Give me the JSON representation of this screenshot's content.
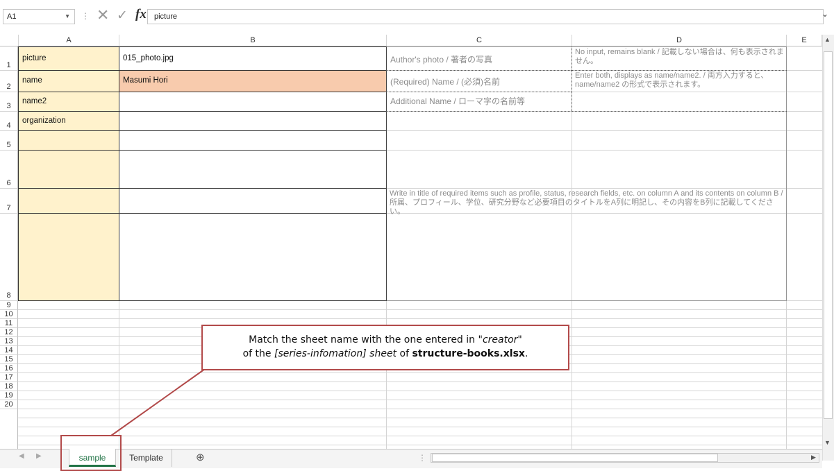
{
  "formula_bar": {
    "name_box": "A1",
    "value": "picture",
    "cancel_icon": "✕",
    "enter_icon": "✓",
    "fx_icon": "fx"
  },
  "columns": [
    "A",
    "B",
    "C",
    "D",
    "E"
  ],
  "rows": [
    "1",
    "2",
    "3",
    "4",
    "5",
    "6",
    "7",
    "8",
    "9",
    "10",
    "11",
    "12",
    "13",
    "14",
    "15",
    "16",
    "17",
    "18",
    "19",
    "20"
  ],
  "cells": {
    "A1": "picture",
    "B1": "015_photo.jpg",
    "A2": "name",
    "B2": "Masumi Hori",
    "A3": "name2",
    "A4": "organization",
    "C1": "Author's photo / 著者の写真",
    "C2": "(Required) Name / (必須)名前",
    "C3": "Additional Name / ローマ字の名前等",
    "D1": "No input, remains blank / 記載しない場合は、何も表示されません。",
    "D2": "Enter both, displays as name/name2. / 両方入力すると、 name/name2 の形式で表示されます。",
    "C4": "Write in title of required items such as profile, status, research fields, etc. on column A and its contents on column B / 所属、プロフィール、学位、研究分野など必要項目のタイトルをA列に明記し、その内容をB列に記載してください。"
  },
  "sheet_tabs": {
    "active": "sample",
    "other": "Template",
    "add": "⊕"
  },
  "callout": {
    "line1_a": "Match the sheet name with the one entered in \"",
    "line1_b": "creator",
    "line1_c": "\"",
    "line2_a": "of the ",
    "line2_b": "[series-infomation] sheet",
    "line2_c": " of ",
    "line2_d": "structure-books.xlsx",
    "line2_e": "."
  },
  "colors": {
    "label_fill": "#fff2cc",
    "name_fill": "#f8cbad",
    "callout_border": "#b24a4a",
    "active_tab_text": "#217346"
  }
}
